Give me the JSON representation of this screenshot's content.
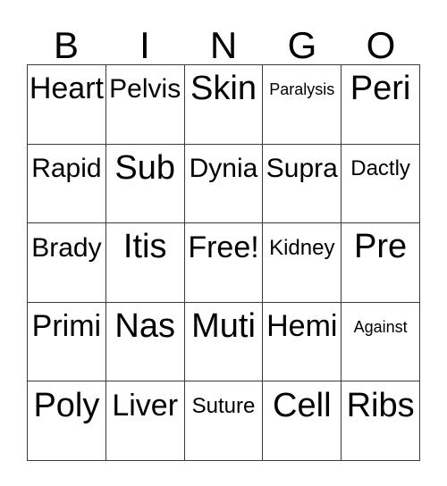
{
  "card": {
    "type": "bingo-card",
    "header": {
      "letters": [
        "B",
        "I",
        "N",
        "G",
        "O"
      ]
    },
    "grid": {
      "rows": 5,
      "columns": 5,
      "free_space_label": "Free!",
      "free_space_position": {
        "row": 3,
        "column": 3
      },
      "border_color": "#3a3a3a",
      "background_color": "#ffffff",
      "text_color": "#000000",
      "cells": [
        [
          {
            "label": "Heart",
            "size": "lg"
          },
          {
            "label": "Pelvis",
            "size": "md"
          },
          {
            "label": "Skin",
            "size": "xl"
          },
          {
            "label": "Paralysis",
            "size": "xs"
          },
          {
            "label": "Peri",
            "size": "xl"
          }
        ],
        [
          {
            "label": "Rapid",
            "size": "md"
          },
          {
            "label": "Sub",
            "size": "xl"
          },
          {
            "label": "Dynia",
            "size": "md"
          },
          {
            "label": "Supra",
            "size": "md"
          },
          {
            "label": "Dactly",
            "size": "sm"
          }
        ],
        [
          {
            "label": "Brady",
            "size": "md"
          },
          {
            "label": "Itis",
            "size": "xl"
          },
          {
            "label": "Free!",
            "size": "lg"
          },
          {
            "label": "Kidney",
            "size": "sm"
          },
          {
            "label": "Pre",
            "size": "xl"
          }
        ],
        [
          {
            "label": "Primi",
            "size": "lg"
          },
          {
            "label": "Nas",
            "size": "xl"
          },
          {
            "label": "Muti",
            "size": "xl"
          },
          {
            "label": "Hemi",
            "size": "lg"
          },
          {
            "label": "Against",
            "size": "xs"
          }
        ],
        [
          {
            "label": "Poly",
            "size": "xl"
          },
          {
            "label": "Liver",
            "size": "lg"
          },
          {
            "label": "Suture",
            "size": "sm"
          },
          {
            "label": "Cell",
            "size": "xl"
          },
          {
            "label": "Ribs",
            "size": "xl"
          }
        ]
      ]
    }
  }
}
